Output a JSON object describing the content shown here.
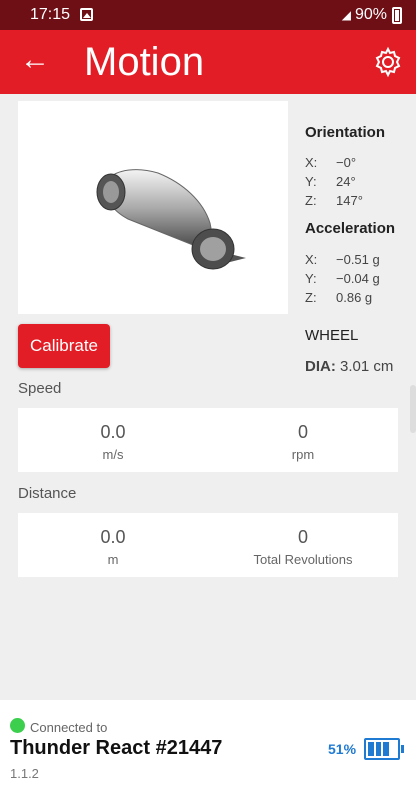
{
  "status": {
    "time": "17:15",
    "battery": "90%"
  },
  "header": {
    "title": "Motion"
  },
  "orientation": {
    "title": "Orientation",
    "x_label": "X:",
    "x": "−0°",
    "y_label": "Y:",
    "y": "24°",
    "z_label": "Z:",
    "z": "147°"
  },
  "acceleration": {
    "title": "Acceleration",
    "x_label": "X:",
    "x": "−0.51 g",
    "y_label": "Y:",
    "y": "−0.04 g",
    "z_label": "Z:",
    "z": "0.86 g"
  },
  "wheel": {
    "label": "WHEEL",
    "dia_label": "DIA:",
    "dia_value": "3.01 cm"
  },
  "calibrate_label": "Calibrate",
  "speed": {
    "label": "Speed",
    "left": {
      "value": "0.0",
      "unit": "m/s"
    },
    "right": {
      "value": "0",
      "unit": "rpm"
    }
  },
  "distance": {
    "label": "Distance",
    "left": {
      "value": "0.0",
      "unit": "m"
    },
    "right": {
      "value": "0",
      "unit": "Total Revolutions"
    }
  },
  "footer": {
    "connected": "Connected to",
    "device": "Thunder React #21447",
    "version": "1.1.2",
    "battery_pct": "51%",
    "battery_level": 0.51
  },
  "icons": {
    "back": "back-arrow-icon",
    "settings": "gear-icon",
    "connection": "connected-dot-icon",
    "battery": "battery-icon"
  },
  "colors": {
    "appbar": "#e31d25",
    "statusbar": "#6e0f16",
    "accent_blue": "#1f7ad1",
    "connected_green": "#3ccf4e"
  }
}
